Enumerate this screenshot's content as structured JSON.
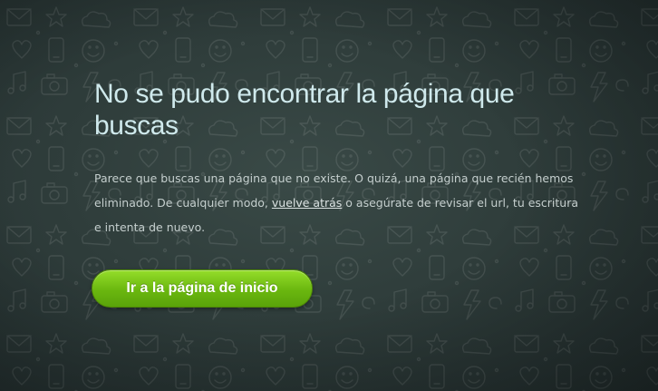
{
  "page": {
    "title": "No se pudo encontrar la página que buscas",
    "message": {
      "before": "Parece que buscas una página que no existe. O quizá, una página que recién hemos eliminado. De cualquier modo, ",
      "link": "vuelve atrás",
      "after": " o asegúrate de revisar el url, tu escritura e intenta de nuevo."
    },
    "home_button": "Ir a la página de inicio"
  },
  "colors": {
    "background": "#2f3d3b",
    "title": "#cfe9ec",
    "text": "#c5cfce",
    "button": "#6ab70f"
  },
  "icons": [
    "doodle-pattern-background"
  ]
}
